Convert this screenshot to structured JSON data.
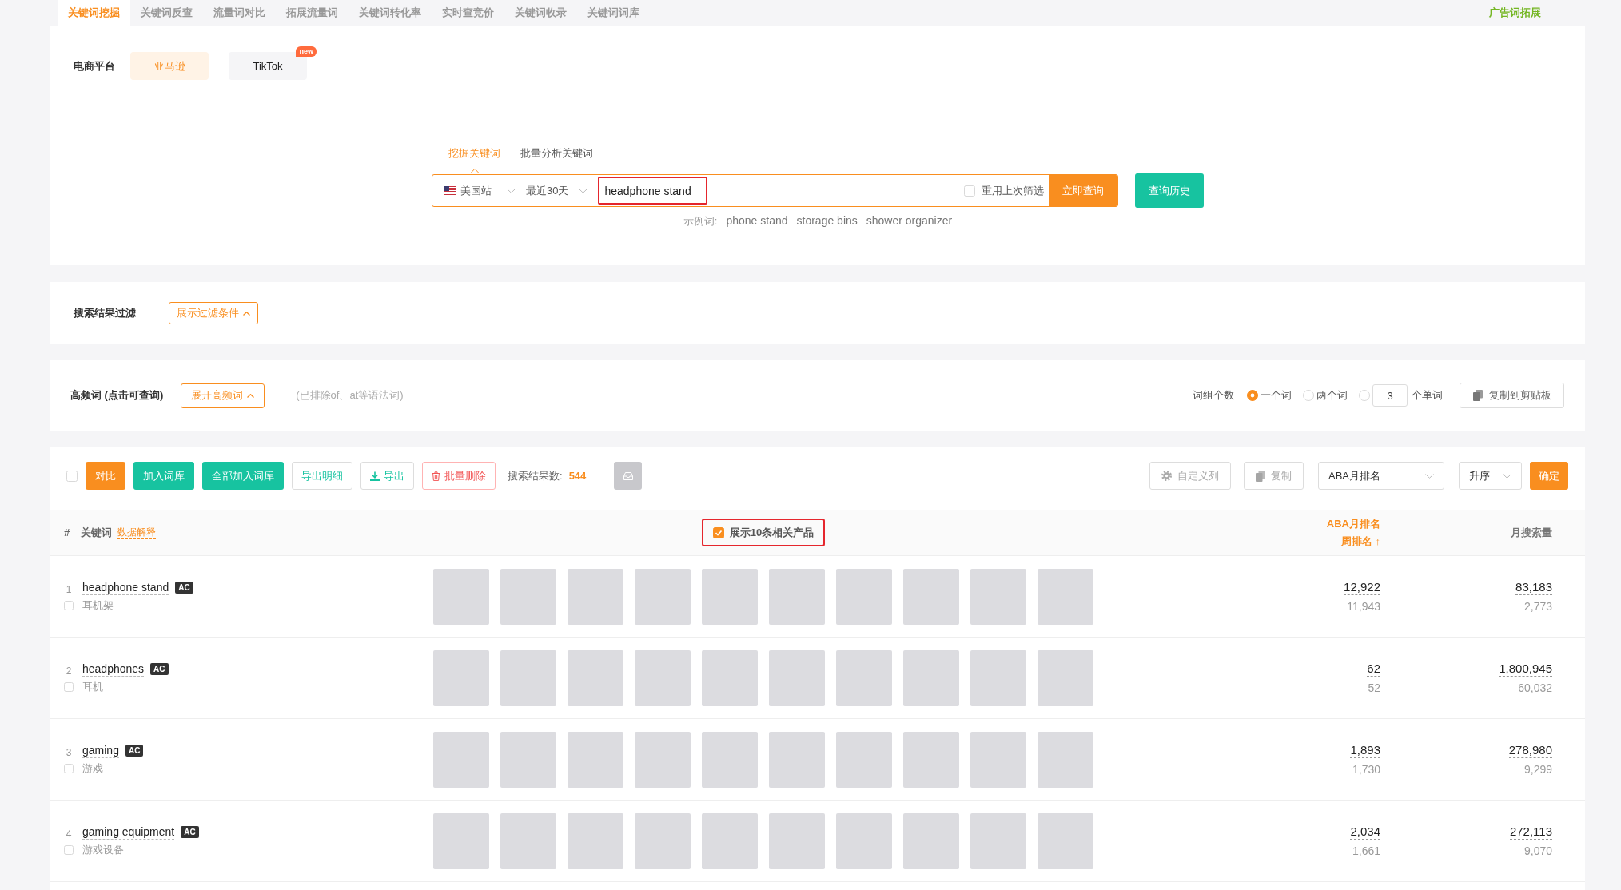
{
  "top_tabs": [
    {
      "label": "关键词挖掘",
      "selected": true
    },
    {
      "label": "关键词反查",
      "selected": false
    },
    {
      "label": "流量词对比",
      "selected": false
    },
    {
      "label": "拓展流量词",
      "selected": false
    },
    {
      "label": "关键词转化率",
      "selected": false
    },
    {
      "label": "实时查竞价",
      "selected": false
    },
    {
      "label": "关键词收录",
      "selected": false
    },
    {
      "label": "关键词词库",
      "selected": false
    }
  ],
  "top_link": "广告词拓展",
  "platform": {
    "label": "电商平台",
    "options": [
      {
        "label": "亚马逊",
        "selected": true
      },
      {
        "label": "TikTok",
        "selected": false,
        "badge": "new"
      }
    ]
  },
  "search": {
    "tabs": [
      {
        "label": "挖掘关键词",
        "selected": true
      },
      {
        "label": "批量分析关键词",
        "selected": false
      }
    ],
    "site": "美国站",
    "period": "最近30天",
    "value": "headphone stand",
    "reuse": {
      "label": "重用上次筛选",
      "checked": false
    },
    "submit": "立即查询",
    "history": "查询历史",
    "examples_label": "示例词:",
    "examples": [
      "phone stand",
      "storage bins",
      "shower organizer"
    ]
  },
  "filter": {
    "label": "搜索结果过滤",
    "toggle": "展示过滤条件"
  },
  "frequent_words": {
    "label": "高频词 (点击可查询)",
    "toggle": "展开高频词",
    "note": "(已排除of、at等语法词)",
    "group_label": "词组个数",
    "options": [
      {
        "kind": "text",
        "label": "一个词",
        "selected": true
      },
      {
        "kind": "text",
        "label": "两个词",
        "selected": false
      },
      {
        "kind": "input",
        "value": "3",
        "suffix": "个单词",
        "selected": false
      }
    ],
    "copy": "复制到剪贴板"
  },
  "toolbar": {
    "select_all": {
      "checked": false
    },
    "buttons": [
      {
        "kind": "primary",
        "label": "对比"
      },
      {
        "kind": "success",
        "label": "加入词库"
      },
      {
        "kind": "success",
        "label": "全部加入词库"
      },
      {
        "kind": "outline",
        "label": "导出明细"
      },
      {
        "kind": "download",
        "label": "导出"
      },
      {
        "kind": "danger",
        "label": "批量删除"
      }
    ],
    "count_label": "搜索结果数:",
    "count": "544",
    "custom_columns": "自定义列",
    "copy": "复制",
    "sort_field": "ABA月排名",
    "sort_order": "升序",
    "confirm": "确定"
  },
  "table": {
    "columns": {
      "index": "#",
      "keyword": "关键词",
      "keyword_help": "数据解释",
      "products": "展示10条相关产品",
      "products_checked": true,
      "rank": "ABA月排名",
      "rank_sub": "周排名 ↑",
      "volume": "月搜索量"
    },
    "rows": [
      {
        "index": "1",
        "keyword": "headphone stand",
        "tag": "AC",
        "translation": "耳机架",
        "checked": false,
        "products": [
          {
            "kind": "photo"
          },
          {
            "kind": "photo"
          },
          {
            "kind": "photo"
          },
          {
            "kind": "photo"
          },
          {
            "kind": "photo"
          },
          {
            "kind": "photo"
          },
          {
            "kind": "photo"
          },
          {
            "kind": "photo"
          },
          {
            "kind": "photo"
          },
          {
            "kind": "photo"
          }
        ],
        "rank": "12,922",
        "rank_sub": "11,943",
        "volume": "83,183",
        "volume_sub": "2,773"
      },
      {
        "index": "2",
        "keyword": "headphones",
        "tag": "AC",
        "translation": "耳机",
        "checked": false,
        "products": [
          {
            "kind": "photo"
          },
          {
            "kind": "photo"
          },
          {
            "kind": "photo"
          },
          {
            "kind": "photo"
          },
          {
            "kind": "photo"
          },
          {
            "kind": "photo"
          },
          {
            "kind": "photo"
          },
          {
            "kind": "photo"
          },
          {
            "kind": "photo"
          },
          {
            "kind": "photo"
          }
        ],
        "rank": "62",
        "rank_sub": "52",
        "volume": "1,800,945",
        "volume_sub": "60,032"
      },
      {
        "index": "3",
        "keyword": "gaming",
        "tag": "AC",
        "translation": "游戏",
        "checked": false,
        "products": [
          {
            "kind": "photo"
          },
          {
            "kind": "photo"
          },
          {
            "kind": "photo"
          },
          {
            "kind": "photo"
          },
          {
            "kind": "photo"
          },
          {
            "kind": "photo"
          },
          {
            "kind": "photo"
          },
          {
            "kind": "photo"
          },
          {
            "kind": "photo"
          },
          {
            "kind": "photo"
          }
        ],
        "rank": "1,893",
        "rank_sub": "1,730",
        "volume": "278,980",
        "volume_sub": "9,299"
      },
      {
        "index": "4",
        "keyword": "gaming equipment",
        "tag": "AC",
        "translation": "游戏设备",
        "checked": false,
        "products": [
          {
            "kind": "photo"
          },
          {
            "kind": "photo"
          },
          {
            "kind": "photo"
          },
          {
            "kind": "photo"
          },
          {
            "kind": "photo"
          },
          {
            "kind": "photo"
          },
          {
            "kind": "photo"
          },
          {
            "kind": "photo"
          },
          {
            "kind": "photo"
          },
          {
            "kind": "photo"
          }
        ],
        "rank": "2,034",
        "rank_sub": "1,661",
        "volume": "272,113",
        "volume_sub": "9,070"
      }
    ]
  }
}
